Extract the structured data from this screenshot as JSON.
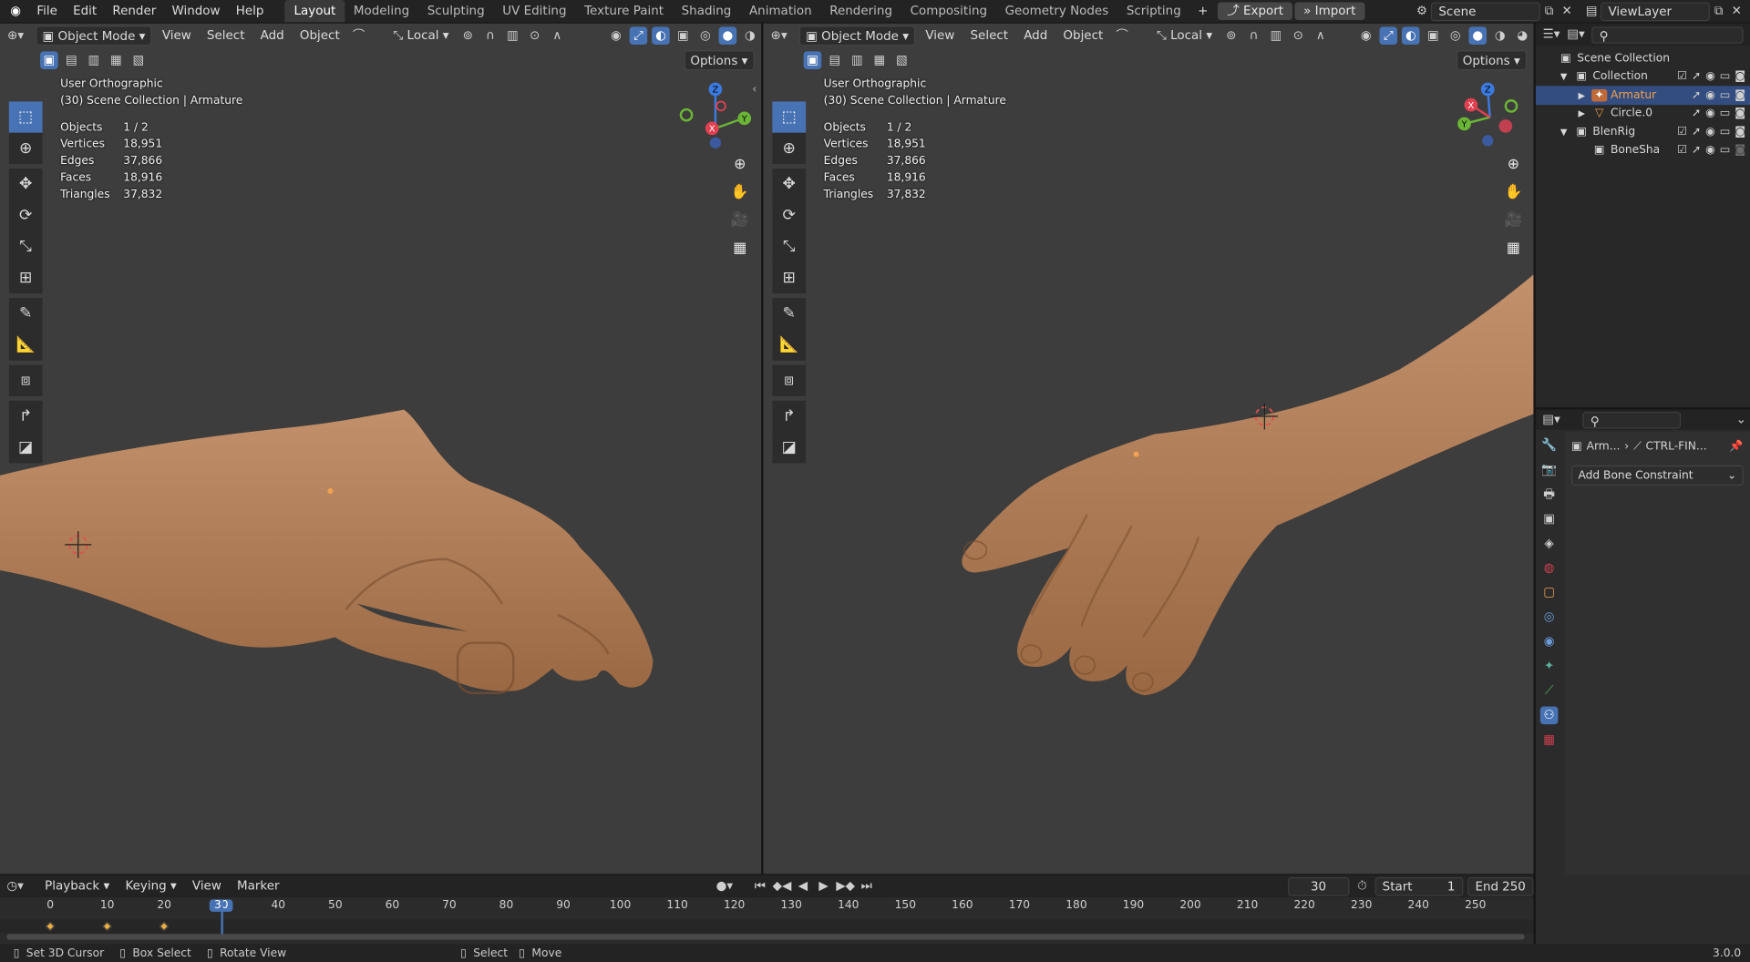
{
  "topbar": {
    "menus": [
      "File",
      "Edit",
      "Render",
      "Window",
      "Help"
    ],
    "workspaces": [
      "Layout",
      "Modeling",
      "Sculpting",
      "UV Editing",
      "Texture Paint",
      "Shading",
      "Animation",
      "Rendering",
      "Compositing",
      "Geometry Nodes",
      "Scripting"
    ],
    "active_workspace": "Layout",
    "add_workspace": "+",
    "export_label": "Export",
    "import_label": "Import",
    "scene_name": "Scene",
    "view_layer": "ViewLayer"
  },
  "viewport_left": {
    "mode": "Object Mode",
    "menus": [
      "View",
      "Select",
      "Add",
      "Object"
    ],
    "orientation": "Local",
    "options": "Options",
    "view_name": "User Orthographic",
    "context": "(30) Scene Collection | Armature",
    "stats": [
      {
        "label": "Objects",
        "value": "1 / 2"
      },
      {
        "label": "Vertices",
        "value": "18,951"
      },
      {
        "label": "Edges",
        "value": "37,866"
      },
      {
        "label": "Faces",
        "value": "18,916"
      },
      {
        "label": "Triangles",
        "value": "37,832"
      }
    ],
    "gizmo": {
      "z": "Z",
      "y": "Y",
      "x": "X"
    }
  },
  "viewport_right": {
    "mode": "Object Mode",
    "menus": [
      "View",
      "Select",
      "Add",
      "Object"
    ],
    "orientation": "Local",
    "options": "Options",
    "view_name": "User Orthographic",
    "context": "(30) Scene Collection | Armature",
    "stats": [
      {
        "label": "Objects",
        "value": "1 / 2"
      },
      {
        "label": "Vertices",
        "value": "18,951"
      },
      {
        "label": "Edges",
        "value": "37,866"
      },
      {
        "label": "Faces",
        "value": "18,916"
      },
      {
        "label": "Triangles",
        "value": "37,832"
      }
    ],
    "gizmo": {
      "z": "Z",
      "y": "Y",
      "x": "X"
    }
  },
  "outliner": {
    "rows": [
      {
        "label": "Scene Collection",
        "icon": "scene-collection-icon"
      },
      {
        "label": "Collection",
        "icon": "collection-icon"
      },
      {
        "label": "Armatur",
        "icon": "armature-icon",
        "selected": true
      },
      {
        "label": "Circle.0",
        "icon": "mesh-icon"
      },
      {
        "label": "BlenRig",
        "icon": "collection-icon"
      },
      {
        "label": "BoneSha",
        "icon": "collection-icon"
      }
    ]
  },
  "properties": {
    "breadcrumb_object": "Arm...",
    "breadcrumb_bone": "CTRL-FIN...",
    "add_constraint": "Add Bone Constraint"
  },
  "timeline": {
    "menus": [
      "Playback",
      "Keying",
      "View",
      "Marker"
    ],
    "current_frame": "30",
    "start_label": "Start",
    "start_value": "1",
    "end_label": "End",
    "end_value": "250",
    "ticks": [
      "0",
      "10",
      "20",
      "30",
      "40",
      "50",
      "60",
      "70",
      "80",
      "90",
      "100",
      "110",
      "120",
      "130",
      "140",
      "150",
      "160",
      "170",
      "180",
      "190",
      "200",
      "210",
      "220",
      "230",
      "240",
      "250"
    ],
    "keyframes": [
      0,
      10,
      20
    ]
  },
  "statusbar": {
    "items": [
      "Set 3D Cursor",
      "Box Select",
      "Rotate View",
      "Select",
      "Move"
    ],
    "version": "3.0.0"
  },
  "colors": {
    "accent": "#4772b3",
    "skin": "#b07a52",
    "viewport_bg": "#3d3d3d",
    "keyframe": "#f0b040",
    "active_object": "#f0a050"
  }
}
